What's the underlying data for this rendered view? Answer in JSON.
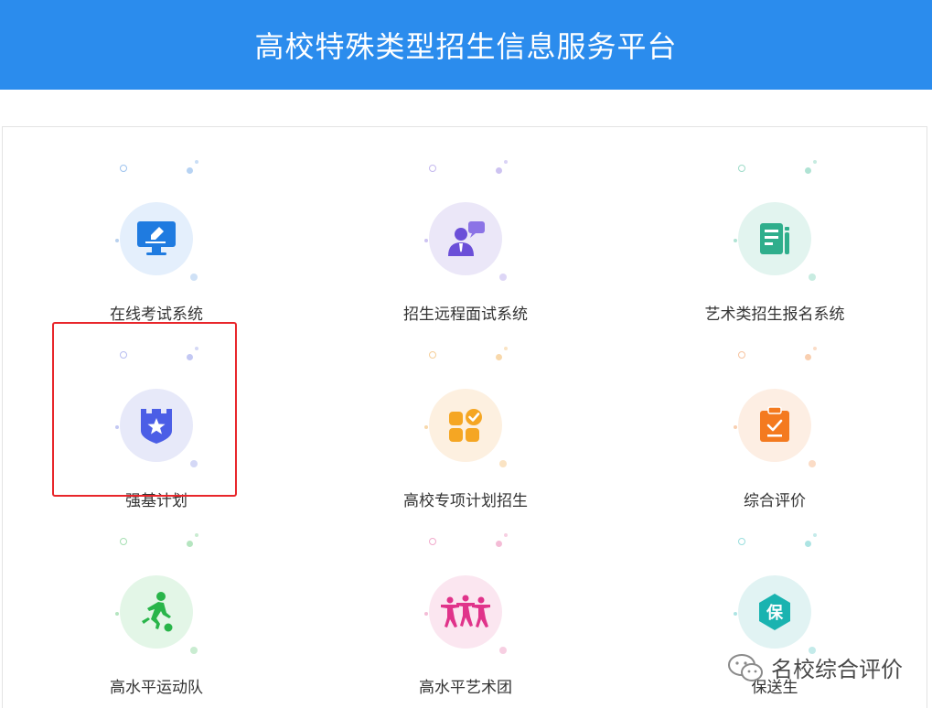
{
  "header": {
    "title": "高校特殊类型招生信息服务平台"
  },
  "tiles": [
    {
      "label": "在线考试系统",
      "icon": "monitor-pen-icon",
      "bg": "#e4effc",
      "accent": "#1f7be0"
    },
    {
      "label": "招生远程面试系统",
      "icon": "interviewer-chat-icon",
      "bg": "#ebe7f8",
      "accent": "#6b4fd8"
    },
    {
      "label": "艺术类招生报名系统",
      "icon": "document-form-icon",
      "bg": "#e2f4ef",
      "accent": "#2fae8c"
    },
    {
      "label": "强基计划",
      "icon": "shield-star-icon",
      "bg": "#e7e9f9",
      "accent": "#4b5ee6"
    },
    {
      "label": "高校专项计划招生",
      "icon": "apps-check-icon",
      "bg": "#fdf0e0",
      "accent": "#f5a623"
    },
    {
      "label": "综合评价",
      "icon": "clipboard-check-icon",
      "bg": "#fdeee3",
      "accent": "#f47a1f"
    },
    {
      "label": "高水平运动队",
      "icon": "soccer-player-icon",
      "bg": "#e3f6e7",
      "accent": "#29b54a"
    },
    {
      "label": "高水平艺术团",
      "icon": "dancers-icon",
      "bg": "#fbe6f0",
      "accent": "#e0338a"
    },
    {
      "label": "保送生",
      "icon": "hexagon-bao-icon",
      "bg": "#e1f3f3",
      "accent": "#1ab3b0",
      "glyph": "保"
    }
  ],
  "highlight": {
    "tile": "强基计划",
    "color": "#e8262b"
  },
  "watermark": {
    "text": "名校综合评价",
    "icon": "wechat-icon"
  }
}
